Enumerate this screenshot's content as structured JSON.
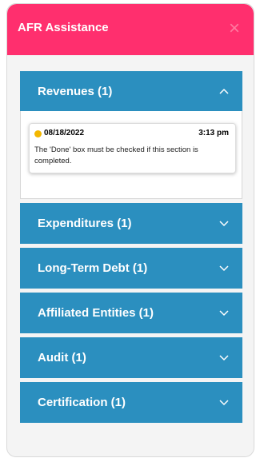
{
  "header": {
    "title": "AFR Assistance",
    "close_icon": "close-icon"
  },
  "accordion": [
    {
      "label": "Revenues (1)",
      "expanded": true
    },
    {
      "label": "Expenditures (1)",
      "expanded": false
    },
    {
      "label": "Long-Term Debt (1)",
      "expanded": false
    },
    {
      "label": "Affiliated Entities (1)",
      "expanded": false
    },
    {
      "label": "Audit (1)",
      "expanded": false
    },
    {
      "label": "Certification (1)",
      "expanded": false
    }
  ],
  "note": {
    "date": "08/18/2022",
    "time": "3:13 pm",
    "text": "The 'Done' box must be checked if this section is completed."
  },
  "colors": {
    "header": "#ff2f6e",
    "accordion": "#2b8fbf",
    "status_dot": "#f3b700"
  }
}
